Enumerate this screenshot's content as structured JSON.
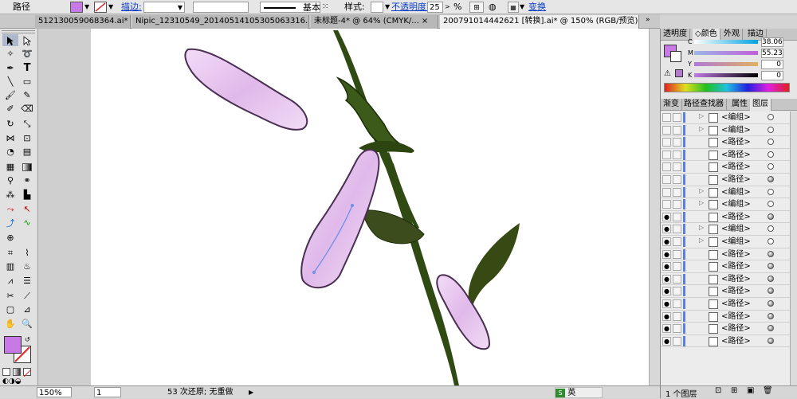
{
  "control_bar": {
    "selection_label": "路径",
    "stroke_label": "描边:",
    "style_value": "基本",
    "style_label": "样式:",
    "opacity_label": "不透明度:",
    "opacity_value": "25",
    "percent": "%",
    "transform_label": "变换",
    "fill_color": "#c77ae6"
  },
  "tabs": [
    {
      "label": "512130059068364.ai*",
      "close": "×"
    },
    {
      "label": "Nipic_12310549_20140514105305063316.ai*",
      "close": "×"
    },
    {
      "label": "未标题-4* @ 64% (CMYK/...",
      "close": "×"
    },
    {
      "label": "200791014442621  [转换].ai* @ 150% (RGB/预览)",
      "close": "×"
    }
  ],
  "status": {
    "zoom": "150%",
    "page": "1",
    "history": "53 次还原; 无重做",
    "ime_label": "英"
  },
  "panel": {
    "color_tabs": [
      "透明度",
      "◇颜色",
      "外观",
      "描边"
    ],
    "cmyk": [
      {
        "label": "C",
        "value": "38.06"
      },
      {
        "label": "M",
        "value": "55.23"
      },
      {
        "label": "Y",
        "value": "0"
      },
      {
        "label": "K",
        "value": "0"
      }
    ],
    "layer_tabs": [
      "渐变",
      "路径查找器",
      "属性",
      "图层"
    ],
    "layers": [
      {
        "name": "<编组>",
        "arrow": "▷",
        "eye": "",
        "target": "outline"
      },
      {
        "name": "<编组>",
        "arrow": "▷",
        "eye": "",
        "target": "outline"
      },
      {
        "name": "<路径>",
        "arrow": "",
        "eye": "",
        "target": "outline"
      },
      {
        "name": "<路径>",
        "arrow": "",
        "eye": "",
        "target": "outline"
      },
      {
        "name": "<路径>",
        "arrow": "",
        "eye": "",
        "target": "outline"
      },
      {
        "name": "<路径>",
        "arrow": "",
        "eye": "",
        "target": "fill"
      },
      {
        "name": "<编组>",
        "arrow": "▷",
        "eye": "",
        "target": "outline"
      },
      {
        "name": "<编组>",
        "arrow": "▷",
        "eye": "",
        "target": "outline"
      },
      {
        "name": "<路径>",
        "arrow": "",
        "eye": "●",
        "target": "fill"
      },
      {
        "name": "<编组>",
        "arrow": "▷",
        "eye": "●",
        "target": "outline"
      },
      {
        "name": "<编组>",
        "arrow": "▷",
        "eye": "●",
        "target": "outline"
      },
      {
        "name": "<路径>",
        "arrow": "",
        "eye": "●",
        "target": "fill"
      },
      {
        "name": "<路径>",
        "arrow": "",
        "eye": "●",
        "target": "fill"
      },
      {
        "name": "<路径>",
        "arrow": "",
        "eye": "●",
        "target": "fill"
      },
      {
        "name": "<路径>",
        "arrow": "",
        "eye": "●",
        "target": "fill"
      },
      {
        "name": "<路径>",
        "arrow": "",
        "eye": "●",
        "target": "fill"
      },
      {
        "name": "<路径>",
        "arrow": "",
        "eye": "●",
        "target": "fill"
      },
      {
        "name": "<路径>",
        "arrow": "",
        "eye": "●",
        "target": "fill"
      },
      {
        "name": "<路径>",
        "arrow": "",
        "eye": "●",
        "target": "fill"
      }
    ],
    "layer_count": "1 个图层"
  },
  "colors": {
    "petal": "#e6c4ee",
    "stem": "#2f4a12",
    "leaf": "#3c5a1a",
    "accent": "#c77ae6"
  }
}
